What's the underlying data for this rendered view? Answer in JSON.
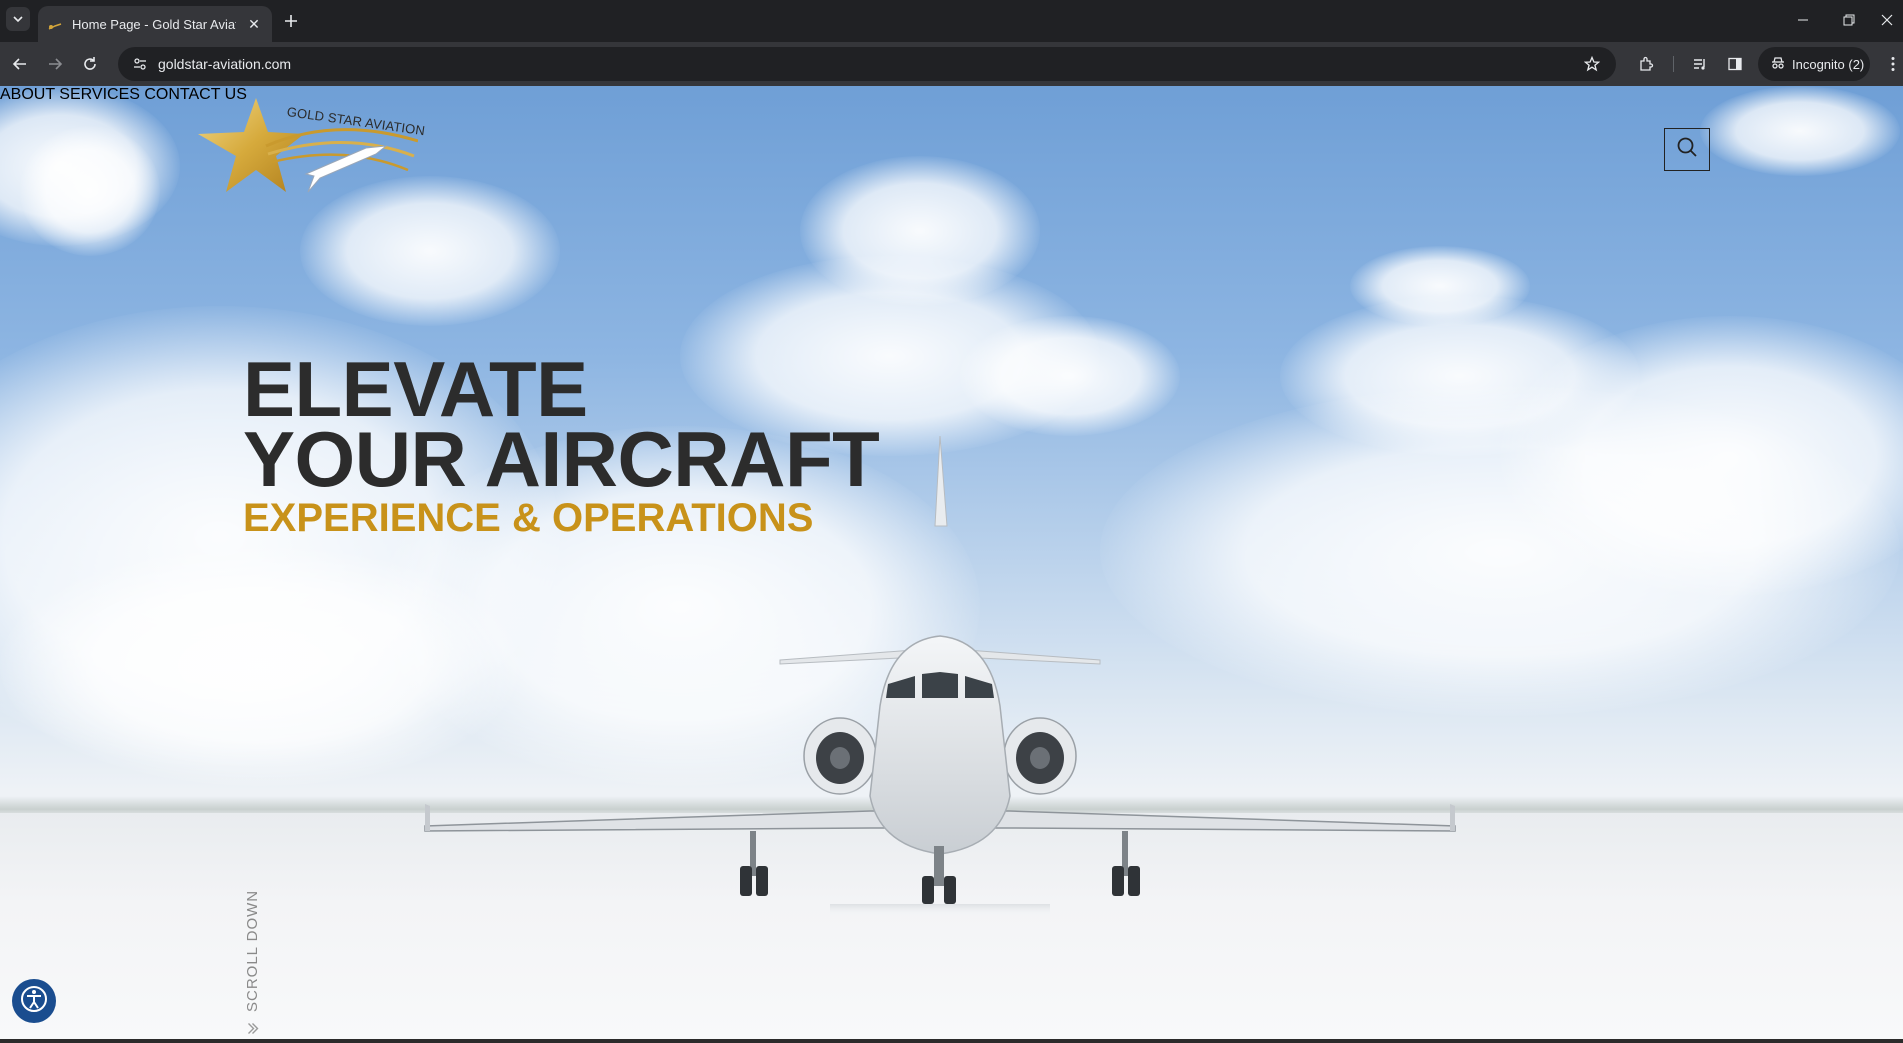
{
  "browser": {
    "tab_title": "Home Page - Gold Star Aviation",
    "url": "goldstar-aviation.com",
    "incognito_label": "Incognito (2)",
    "new_tab": "+",
    "close_tab": "✕"
  },
  "site": {
    "logo_text": "GOLD STAR AVIATION",
    "nav": [
      "ABOUT",
      "SERVICES",
      "CONTACT US"
    ],
    "hero": {
      "line1": "ELEVATE",
      "line2": "YOUR AIRCRAFT",
      "subtitle": "EXPERIENCE & OPERATIONS"
    },
    "scroll_label": "SCROLL DOWN"
  },
  "colors": {
    "accent_gold": "#c8921a",
    "heading_dark": "#2c2c2c",
    "a11y_blue": "#1a4d8f"
  },
  "icons": [
    "tab-search-icon",
    "back-icon",
    "forward-icon",
    "reload-icon",
    "site-info-icon",
    "star-bookmark-icon",
    "extensions-icon",
    "media-icon",
    "side-panel-icon",
    "incognito-icon",
    "menu-icon",
    "search-icon",
    "accessibility-icon"
  ]
}
